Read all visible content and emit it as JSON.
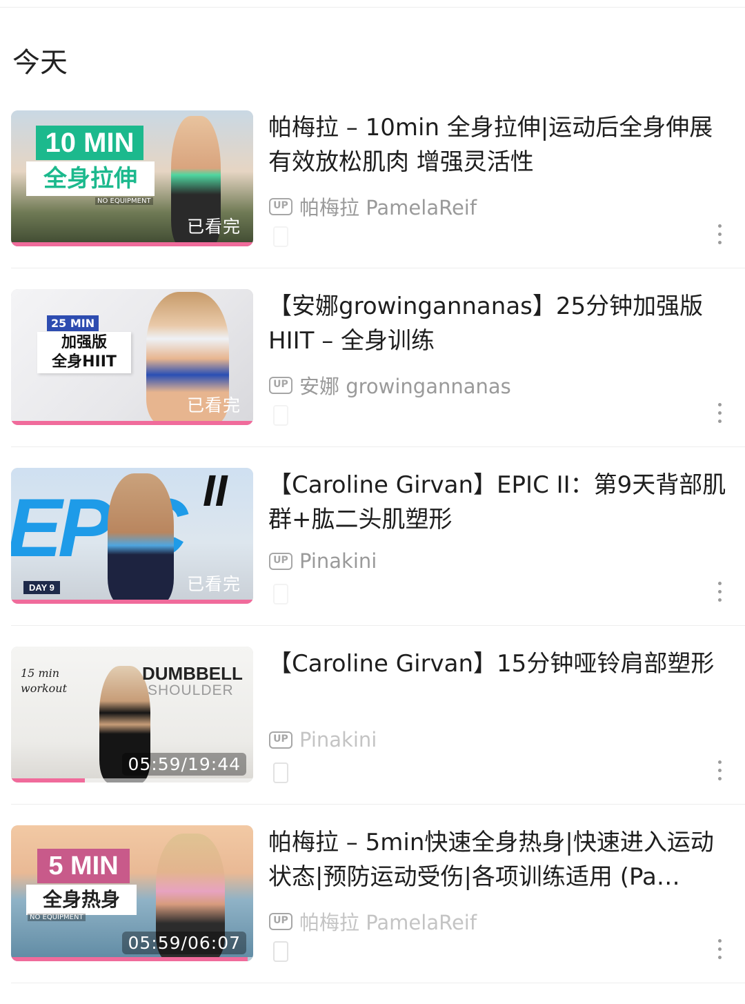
{
  "section": {
    "title": "今天"
  },
  "items": [
    {
      "title": "帕梅拉 – 10min 全身拉伸|运动后全身伸展 有效放松肌肉 增强灵活性",
      "uploader": "帕梅拉 PamelaReif",
      "badge": "已看完",
      "progress": 1.0,
      "thumb": {
        "big": "10 MIN",
        "sub": "全身拉伸",
        "tiny": "NO EQUIPMENT"
      }
    },
    {
      "title": "【安娜growingannanas】25分钟加强版HIIT – 全身训练",
      "uploader": "安娜 growingannanas",
      "badge": "已看完",
      "progress": 1.0,
      "thumb": {
        "big": "25 MIN",
        "sub": "加强版",
        "sub2": "全身HIIT"
      }
    },
    {
      "title": "【Caroline Girvan】EPIC II：第9天背部肌群+肱二头肌塑形",
      "uploader": "Pinakini",
      "badge": "已看完",
      "progress": 1.0,
      "thumb": {
        "big": "EPIC",
        "sub": "II",
        "tiny": "DAY 9"
      }
    },
    {
      "title": "【Caroline Girvan】15分钟哑铃肩部塑形",
      "uploader": "Pinakini",
      "badge": "05:59/19:44",
      "progress": 0.305,
      "thumb": {
        "big": "DUMBBELL",
        "sub": "SHOULDER",
        "tiny": "15 min workout"
      }
    },
    {
      "title": "帕梅拉 – 5min快速全身热身|快速进入运动状态|预防运动受伤|各项训练适用 (Pa…",
      "uploader": "帕梅拉 PamelaReif",
      "badge": "05:59/06:07",
      "progress": 0.978,
      "thumb": {
        "big": "5 MIN",
        "sub": "全身热身",
        "tiny": "NO EQUIPMENT"
      }
    }
  ],
  "colors": {
    "progress": "#f06b9b",
    "green": "#1cb98d",
    "pink": "#c85a8a"
  },
  "icons": {
    "uploader": "up-badge-icon",
    "more": "more-vertical-icon",
    "device": "phone-icon"
  }
}
